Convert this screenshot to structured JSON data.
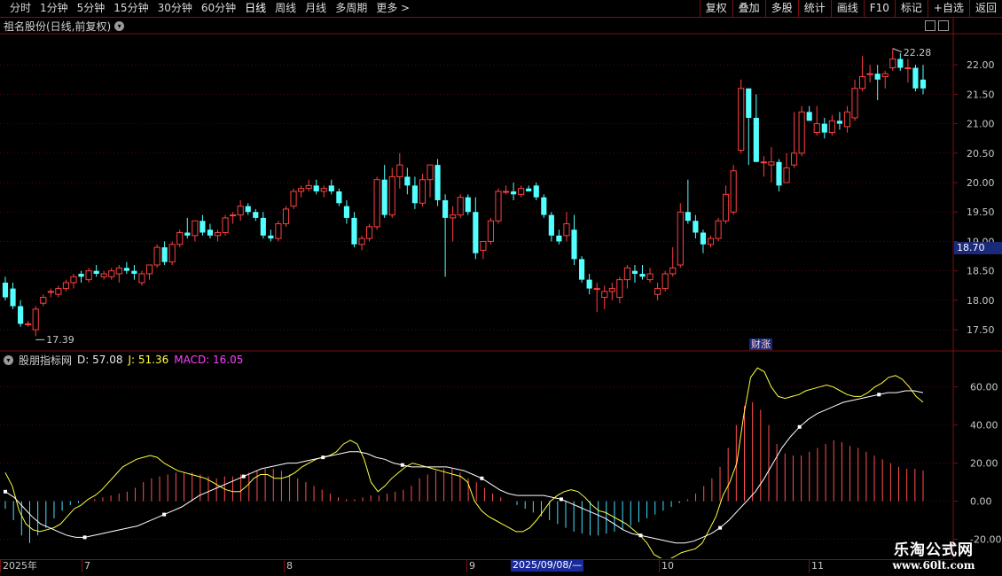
{
  "toolbar": {
    "periods": [
      "分时",
      "1分钟",
      "5分钟",
      "15分钟",
      "30分钟",
      "60分钟",
      "日线",
      "周线",
      "月线",
      "多周期",
      "更多 >"
    ],
    "active_period": "日线",
    "right_buttons": [
      "复权",
      "叠加",
      "多股",
      "统计",
      "画线",
      "F10",
      "标记",
      "+自选",
      "返回"
    ]
  },
  "main_chart": {
    "title": "祖名股份(日线,前复权)",
    "high_marker": "22.28",
    "low_marker": "17.39",
    "current_price_tag": "18.70",
    "event_tag": "财涨",
    "y_ticks": [
      "22.00",
      "21.50",
      "21.00",
      "20.50",
      "20.00",
      "19.50",
      "19.00",
      "18.50",
      "18.00",
      "17.50"
    ]
  },
  "indicator": {
    "name": "股朋指标网",
    "d_label": "D: 57.08",
    "j_label": "J: 51.36",
    "macd_label": "MACD: 16.05",
    "y_ticks": [
      "60.00",
      "40.00",
      "20.00",
      "0.00",
      "-20.00"
    ]
  },
  "x_axis": {
    "labels": [
      "2025年",
      "7",
      "8",
      "9",
      "10",
      "11"
    ],
    "cursor_date": "2025/09/08/—"
  },
  "watermark": {
    "line1": "乐淘公式网",
    "line2": "www.60lt.com"
  },
  "colors": {
    "up": "#ff4040",
    "down": "#54ffff",
    "k_line": "#ffff40",
    "d_line": "#ffffff",
    "macd_up": "#ff5050",
    "macd_down": "#40e0ff",
    "grid": "#7a1010"
  },
  "chart_data": [
    {
      "type": "candlestick",
      "title": "祖名股份(日线,前复权)",
      "ylim": [
        17.3,
        22.4
      ],
      "candles_ohlc": [
        [
          18.3,
          18.4,
          18.0,
          18.05
        ],
        [
          18.2,
          18.3,
          17.85,
          17.9
        ],
        [
          17.9,
          18.0,
          17.55,
          17.6
        ],
        [
          17.6,
          17.65,
          17.55,
          17.6
        ],
        [
          17.5,
          17.9,
          17.39,
          17.85
        ],
        [
          17.95,
          18.1,
          17.9,
          18.05
        ],
        [
          18.15,
          18.2,
          18.05,
          18.15
        ],
        [
          18.1,
          18.25,
          18.05,
          18.2
        ],
        [
          18.2,
          18.35,
          18.15,
          18.3
        ],
        [
          18.3,
          18.45,
          18.2,
          18.4
        ],
        [
          18.45,
          18.5,
          18.3,
          18.4
        ],
        [
          18.35,
          18.55,
          18.3,
          18.5
        ],
        [
          18.5,
          18.6,
          18.4,
          18.45
        ],
        [
          18.4,
          18.5,
          18.35,
          18.45
        ],
        [
          18.4,
          18.55,
          18.35,
          18.5
        ],
        [
          18.45,
          18.6,
          18.3,
          18.55
        ],
        [
          18.55,
          18.65,
          18.45,
          18.5
        ],
        [
          18.5,
          18.6,
          18.35,
          18.45
        ],
        [
          18.3,
          18.5,
          18.25,
          18.45
        ],
        [
          18.45,
          18.6,
          18.35,
          18.6
        ],
        [
          18.6,
          18.95,
          18.55,
          18.9
        ],
        [
          18.9,
          19.0,
          18.6,
          18.65
        ],
        [
          18.65,
          19.0,
          18.6,
          18.95
        ],
        [
          18.95,
          19.2,
          18.9,
          19.15
        ],
        [
          19.15,
          19.4,
          19.05,
          19.1
        ],
        [
          19.1,
          19.35,
          19.0,
          19.35
        ],
        [
          19.35,
          19.45,
          19.1,
          19.15
        ],
        [
          19.2,
          19.3,
          19.05,
          19.1
        ],
        [
          19.1,
          19.2,
          19.0,
          19.15
        ],
        [
          19.15,
          19.45,
          19.1,
          19.4
        ],
        [
          19.45,
          19.5,
          19.3,
          19.45
        ],
        [
          19.45,
          19.7,
          19.35,
          19.6
        ],
        [
          19.6,
          19.65,
          19.45,
          19.5
        ],
        [
          19.5,
          19.55,
          19.35,
          19.4
        ],
        [
          19.4,
          19.5,
          19.05,
          19.1
        ],
        [
          19.1,
          19.2,
          19.0,
          19.05
        ],
        [
          19.05,
          19.35,
          19.0,
          19.3
        ],
        [
          19.3,
          19.6,
          19.25,
          19.55
        ],
        [
          19.6,
          19.9,
          19.55,
          19.85
        ],
        [
          19.85,
          19.95,
          19.75,
          19.9
        ],
        [
          19.9,
          20.05,
          19.85,
          19.95
        ],
        [
          19.95,
          20.05,
          19.8,
          19.85
        ],
        [
          19.85,
          19.95,
          19.75,
          19.9
        ],
        [
          19.95,
          20.05,
          19.8,
          19.85
        ],
        [
          19.85,
          19.9,
          19.6,
          19.65
        ],
        [
          19.6,
          19.7,
          19.3,
          19.4
        ],
        [
          19.4,
          19.5,
          18.9,
          18.95
        ],
        [
          18.95,
          19.1,
          18.85,
          19.05
        ],
        [
          19.05,
          19.3,
          19.0,
          19.25
        ],
        [
          19.25,
          20.1,
          19.2,
          20.05
        ],
        [
          20.05,
          20.3,
          19.4,
          19.45
        ],
        [
          19.45,
          20.25,
          19.4,
          20.1
        ],
        [
          20.1,
          20.5,
          19.9,
          20.3
        ],
        [
          20.1,
          20.25,
          19.8,
          19.95
        ],
        [
          19.95,
          20.1,
          19.55,
          19.65
        ],
        [
          19.65,
          20.15,
          19.6,
          20.05
        ],
        [
          20.05,
          20.3,
          19.75,
          20.3
        ],
        [
          20.3,
          20.4,
          19.6,
          19.7
        ],
        [
          19.7,
          19.8,
          18.4,
          19.4
        ],
        [
          19.4,
          19.6,
          19.0,
          19.45
        ],
        [
          19.45,
          19.8,
          19.4,
          19.75
        ],
        [
          19.75,
          19.8,
          19.45,
          19.5
        ],
        [
          19.5,
          19.75,
          18.7,
          18.8
        ],
        [
          18.85,
          19.0,
          18.7,
          19.0
        ],
        [
          19.0,
          19.4,
          18.95,
          19.35
        ],
        [
          19.35,
          19.9,
          19.3,
          19.85
        ],
        [
          19.85,
          19.95,
          19.8,
          19.85
        ],
        [
          19.85,
          20.0,
          19.7,
          19.8
        ],
        [
          19.8,
          19.95,
          19.75,
          19.9
        ],
        [
          19.9,
          19.95,
          19.85,
          19.85
        ],
        [
          19.95,
          20.0,
          19.7,
          19.75
        ],
        [
          19.75,
          19.8,
          19.4,
          19.45
        ],
        [
          19.45,
          19.5,
          19.0,
          19.1
        ],
        [
          19.1,
          19.2,
          18.95,
          19.0
        ],
        [
          19.1,
          19.5,
          19.0,
          19.3
        ],
        [
          19.2,
          19.45,
          18.6,
          18.7
        ],
        [
          18.7,
          18.75,
          18.3,
          18.35
        ],
        [
          18.35,
          18.45,
          18.1,
          18.2
        ],
        [
          18.2,
          18.3,
          17.8,
          18.2
        ],
        [
          18.05,
          18.25,
          17.85,
          18.15
        ],
        [
          18.15,
          18.3,
          18.0,
          18.2
        ],
        [
          18.05,
          18.4,
          17.95,
          18.35
        ],
        [
          18.35,
          18.6,
          18.2,
          18.55
        ],
        [
          18.5,
          18.6,
          18.3,
          18.45
        ],
        [
          18.45,
          18.6,
          18.35,
          18.4
        ],
        [
          18.35,
          18.55,
          18.3,
          18.45
        ],
        [
          18.1,
          18.3,
          18.0,
          18.2
        ],
        [
          18.2,
          18.5,
          18.15,
          18.45
        ],
        [
          18.45,
          18.9,
          18.4,
          18.55
        ],
        [
          18.6,
          19.65,
          18.55,
          19.5
        ],
        [
          19.5,
          20.05,
          19.3,
          19.35
        ],
        [
          19.35,
          19.45,
          19.05,
          19.15
        ],
        [
          19.15,
          19.2,
          18.8,
          18.95
        ],
        [
          18.95,
          19.1,
          18.9,
          19.05
        ],
        [
          19.05,
          19.4,
          19.0,
          19.35
        ],
        [
          19.35,
          19.95,
          19.3,
          19.8
        ],
        [
          19.5,
          20.3,
          19.45,
          20.2
        ],
        [
          20.55,
          21.75,
          20.5,
          21.6
        ],
        [
          21.6,
          21.6,
          20.3,
          21.1
        ],
        [
          21.1,
          21.5,
          20.4,
          20.35
        ],
        [
          20.35,
          20.45,
          20.1,
          20.35
        ],
        [
          20.3,
          20.6,
          20.0,
          20.35
        ],
        [
          20.35,
          20.4,
          19.85,
          19.95
        ],
        [
          20.0,
          20.5,
          20.0,
          20.25
        ],
        [
          20.3,
          21.2,
          20.25,
          20.5
        ],
        [
          20.5,
          21.3,
          20.45,
          21.2
        ],
        [
          21.2,
          21.3,
          21.05,
          21.05
        ],
        [
          20.85,
          21.3,
          20.8,
          21.0
        ],
        [
          21.0,
          21.1,
          20.75,
          20.85
        ],
        [
          20.85,
          21.15,
          20.8,
          21.05
        ],
        [
          21.05,
          21.2,
          20.9,
          21.0
        ],
        [
          20.95,
          21.3,
          20.85,
          21.2
        ],
        [
          21.1,
          21.75,
          21.05,
          21.6
        ],
        [
          21.6,
          22.15,
          21.55,
          21.8
        ],
        [
          21.85,
          22.0,
          21.7,
          21.85
        ],
        [
          21.85,
          22.0,
          21.4,
          21.75
        ],
        [
          21.8,
          21.9,
          21.6,
          21.85
        ],
        [
          21.95,
          22.28,
          21.9,
          22.1
        ],
        [
          22.1,
          22.2,
          21.9,
          21.95
        ],
        [
          21.95,
          22.1,
          21.7,
          21.95
        ],
        [
          21.95,
          22.0,
          21.55,
          21.6
        ],
        [
          21.75,
          22.0,
          21.5,
          21.6
        ]
      ]
    },
    {
      "type": "line",
      "title": "股朋指标网",
      "ylim": [
        -30,
        78
      ],
      "series": [
        {
          "name": "J",
          "values": [
            15,
            8,
            -5,
            -12,
            -15,
            -16,
            -15,
            -14,
            -12,
            -8,
            -4,
            -2,
            1,
            3,
            6,
            10,
            14,
            18,
            20,
            22,
            23,
            24,
            23,
            20,
            18,
            16,
            15,
            14,
            13,
            12,
            10,
            8,
            6,
            5,
            5,
            8,
            12,
            14,
            14,
            12,
            12,
            13,
            15,
            18,
            20,
            22,
            23,
            24,
            26,
            30,
            32,
            30,
            22,
            10,
            5,
            8,
            12,
            15,
            18,
            20,
            19,
            18,
            17,
            16,
            15,
            14,
            13,
            10,
            0,
            -5,
            -8,
            -10,
            -12,
            -14,
            -16,
            -16,
            -14,
            -10,
            -5,
            0,
            3,
            5,
            6,
            5,
            2,
            -2,
            -5,
            -6,
            -8,
            -10,
            -12,
            -15,
            -18,
            -22,
            -28,
            -30,
            -31,
            -29,
            -27,
            -26,
            -25,
            -22,
            -15,
            -8,
            3,
            10,
            20,
            45,
            65,
            70,
            68,
            60,
            55,
            54,
            55,
            56,
            58,
            59,
            60,
            61,
            60,
            58,
            56,
            55,
            55,
            57,
            60,
            62,
            65,
            66,
            64,
            60,
            55,
            52
          ]
        },
        {
          "name": "D",
          "values": [
            5,
            2,
            -3,
            -8,
            -12,
            -14,
            -16,
            -18,
            -19,
            -19,
            -18,
            -17,
            -16,
            -15,
            -14,
            -13,
            -11,
            -9,
            -7,
            -5,
            -3,
            0,
            3,
            5,
            7,
            9,
            11,
            13,
            15,
            17,
            18,
            19,
            20,
            20,
            21,
            22,
            23,
            24,
            25,
            26,
            26,
            25,
            23,
            22,
            20,
            19,
            18,
            18,
            18,
            18,
            18,
            17,
            16,
            14,
            12,
            9,
            6,
            4,
            3,
            3,
            3,
            3,
            2,
            1,
            -1,
            -3,
            -5,
            -7,
            -9,
            -12,
            -15,
            -17,
            -18,
            -19,
            -20,
            -21,
            -22,
            -22,
            -21,
            -19,
            -17,
            -14,
            -10,
            -5,
            0,
            5,
            12,
            20,
            28,
            34,
            39,
            43,
            46,
            48,
            50,
            52,
            53,
            54,
            55,
            56,
            57,
            57,
            58,
            58,
            57
          ]
        }
      ],
      "macd_values": [
        -4,
        -10,
        -18,
        -22,
        -18,
        -14,
        -9,
        -5,
        -2,
        -1,
        0,
        1,
        2,
        3,
        4,
        5,
        7,
        10,
        12,
        13,
        14,
        15,
        15,
        15,
        14,
        13,
        12,
        13,
        13,
        14,
        15,
        16,
        17,
        17,
        16,
        14,
        12,
        10,
        8,
        6,
        4,
        2,
        1,
        1,
        2,
        3,
        3,
        4,
        5,
        6,
        8,
        12,
        14,
        16,
        17,
        17,
        15,
        12,
        10,
        7,
        4,
        2,
        0,
        -2,
        -4,
        -6,
        -8,
        -10,
        -12,
        -14,
        -16,
        -17,
        -18,
        -18,
        -17,
        -16,
        -15,
        -13,
        -11,
        -9,
        -7,
        -5,
        -3,
        -1,
        1,
        4,
        8,
        12,
        18,
        28,
        40,
        50,
        52,
        48,
        40,
        30,
        25,
        24,
        24,
        26,
        28,
        30,
        32,
        31,
        29,
        28,
        26,
        24,
        22,
        20,
        18,
        17,
        17,
        16
      ]
    }
  ]
}
